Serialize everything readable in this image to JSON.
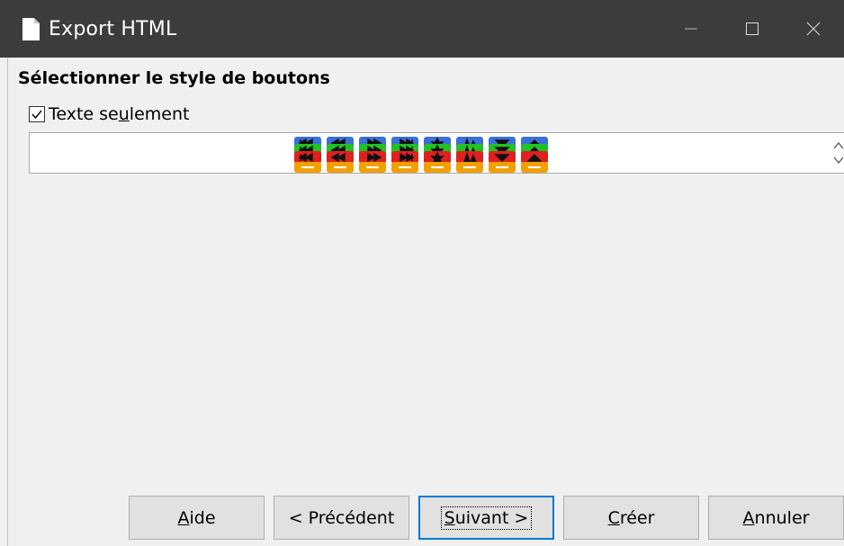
{
  "window": {
    "title": "Export HTML",
    "controls": [
      "minimize-icon",
      "maximize-icon",
      "close-icon"
    ],
    "titlebar_color": "#3c3c3c"
  },
  "section": {
    "title": "Sélectionner le style de boutons"
  },
  "text_only": {
    "label_before": "Texte se",
    "label_mnemonic": "u",
    "label_after": "lement",
    "checked": true
  },
  "button_style_icons": [
    "first-page-icon",
    "previous-page-icon",
    "next-page-icon",
    "last-page-icon",
    "contents-icon",
    "text-icon",
    "zoom-in-icon",
    "zoom-out-icon"
  ],
  "buttons": {
    "help": {
      "mnemonic": "A",
      "rest": "ide"
    },
    "previous": {
      "label": "< Précédent"
    },
    "next": {
      "mnemonic": "S",
      "rest": "uivant >"
    },
    "create": {
      "mnemonic": "C",
      "rest": "réer"
    },
    "cancel": {
      "mnemonic": "A",
      "rest": "nnuler"
    }
  },
  "colors": {
    "accent": "#0078d7",
    "icon_blue": "#3a6fd8",
    "icon_green": "#23c223",
    "icon_red": "#e02020",
    "icon_orange": "#f0a000"
  }
}
